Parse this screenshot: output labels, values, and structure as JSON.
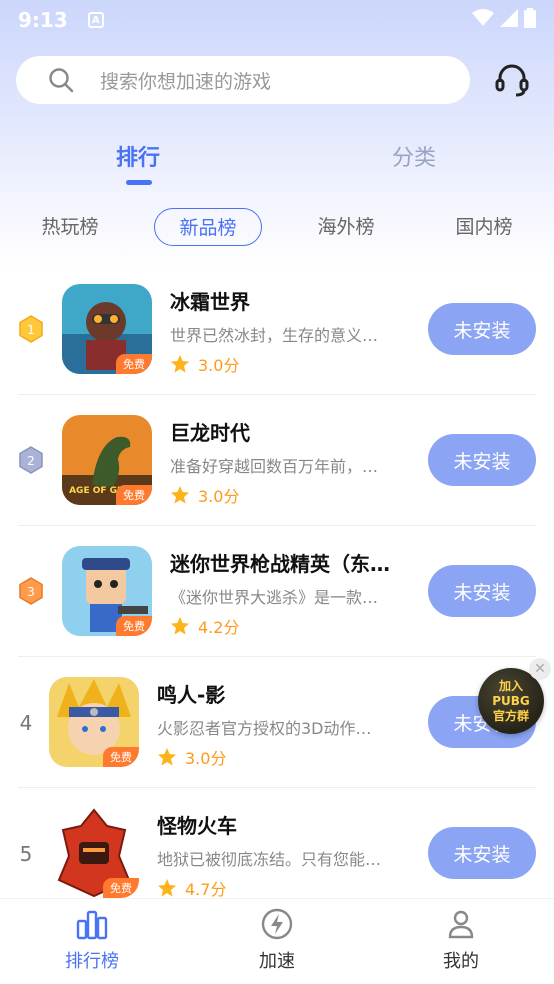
{
  "status_bar": {
    "time": "9:13"
  },
  "search": {
    "placeholder": "搜索你想加速的游戏"
  },
  "main_tabs": [
    {
      "label": "排行",
      "active": true
    },
    {
      "label": "分类",
      "active": false
    }
  ],
  "sub_tabs": [
    {
      "label": "热玩榜",
      "active": false
    },
    {
      "label": "新品榜",
      "active": true
    },
    {
      "label": "海外榜",
      "active": false
    },
    {
      "label": "国内榜",
      "active": false
    }
  ],
  "free_tag": "免费",
  "games": [
    {
      "rank": "1",
      "title": "冰霜世界",
      "desc": "世界已然冰封，生存的意义…",
      "score": "3.0分",
      "button": "未安装",
      "icon": "frost-world-icon"
    },
    {
      "rank": "2",
      "title": "巨龙时代",
      "desc": "准备好穿越回数百万年前，…",
      "score": "3.0分",
      "button": "未安装",
      "icon": "dragon-age-icon",
      "icon_text": "AGE OF GIAN"
    },
    {
      "rank": "3",
      "title": "迷你世界枪战精英（东…",
      "desc": "《迷你世界大逃杀》是一款…",
      "score": "4.2分",
      "button": "未安装",
      "icon": "mini-world-icon"
    },
    {
      "rank": "4",
      "title": "鸣人-影",
      "desc": "火影忍者官方授权的3D动作…",
      "score": "3.0分",
      "button": "未安装",
      "icon": "naruto-icon"
    },
    {
      "rank": "5",
      "title": "怪物火车",
      "desc": "地狱已被彻底冻结。只有您能…",
      "score": "4.7分",
      "button": "未安装",
      "icon": "monster-train-icon"
    }
  ],
  "float_banner": {
    "line1": "加入",
    "line2": "PUBG",
    "line3": "官方群"
  },
  "bottom_nav": [
    {
      "label": "排行榜",
      "icon": "ranking-icon",
      "active": true
    },
    {
      "label": "加速",
      "icon": "boost-icon",
      "active": false
    },
    {
      "label": "我的",
      "icon": "profile-icon",
      "active": false
    }
  ],
  "colors": {
    "accent": "#4a72f5",
    "button": "#8ca4f4",
    "star": "#ffb31a",
    "free_tag": "#ff7a2e"
  }
}
